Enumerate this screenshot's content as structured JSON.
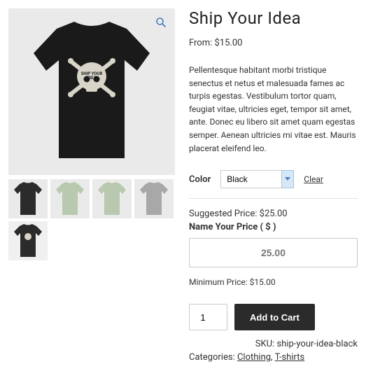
{
  "product": {
    "title": "Ship Your Idea",
    "from_label": "From:",
    "from_price": "$15.00",
    "description": "Pellentesque habitant morbi tristique senectus et netus et malesuada fames ac turpis egestas. Vestibulum tortor quam, feugiat vitae, ultricies eget, tempor sit amet, ante. Donec eu libero sit amet quam egestas semper. Aenean ultricies mi vitae est. Mauris placerat eleifend leo."
  },
  "variation": {
    "label": "Color",
    "selected": "Black",
    "clear": "Clear"
  },
  "nyp": {
    "suggested_label": "Suggested Price:",
    "suggested_value": "$25.00",
    "label": "Name Your Price ( $ )",
    "value": "25.00",
    "min_label": "Minimum Price:",
    "min_value": "$15.00"
  },
  "cart": {
    "qty": "1",
    "add_label": "Add to Cart"
  },
  "meta": {
    "sku_label": "SKU:",
    "sku_value": "ship-your-idea-black",
    "cat_label": "Categories:",
    "cat1": "Clothing",
    "cat2": "T-shirts"
  },
  "thumbs": {
    "t1_color": "#2b2b2b",
    "t2_color": "#b8c9b0",
    "t3_color": "#b8c9b0",
    "t4_color": "#a8a8a8",
    "t5_color": "#2b2b2b"
  }
}
